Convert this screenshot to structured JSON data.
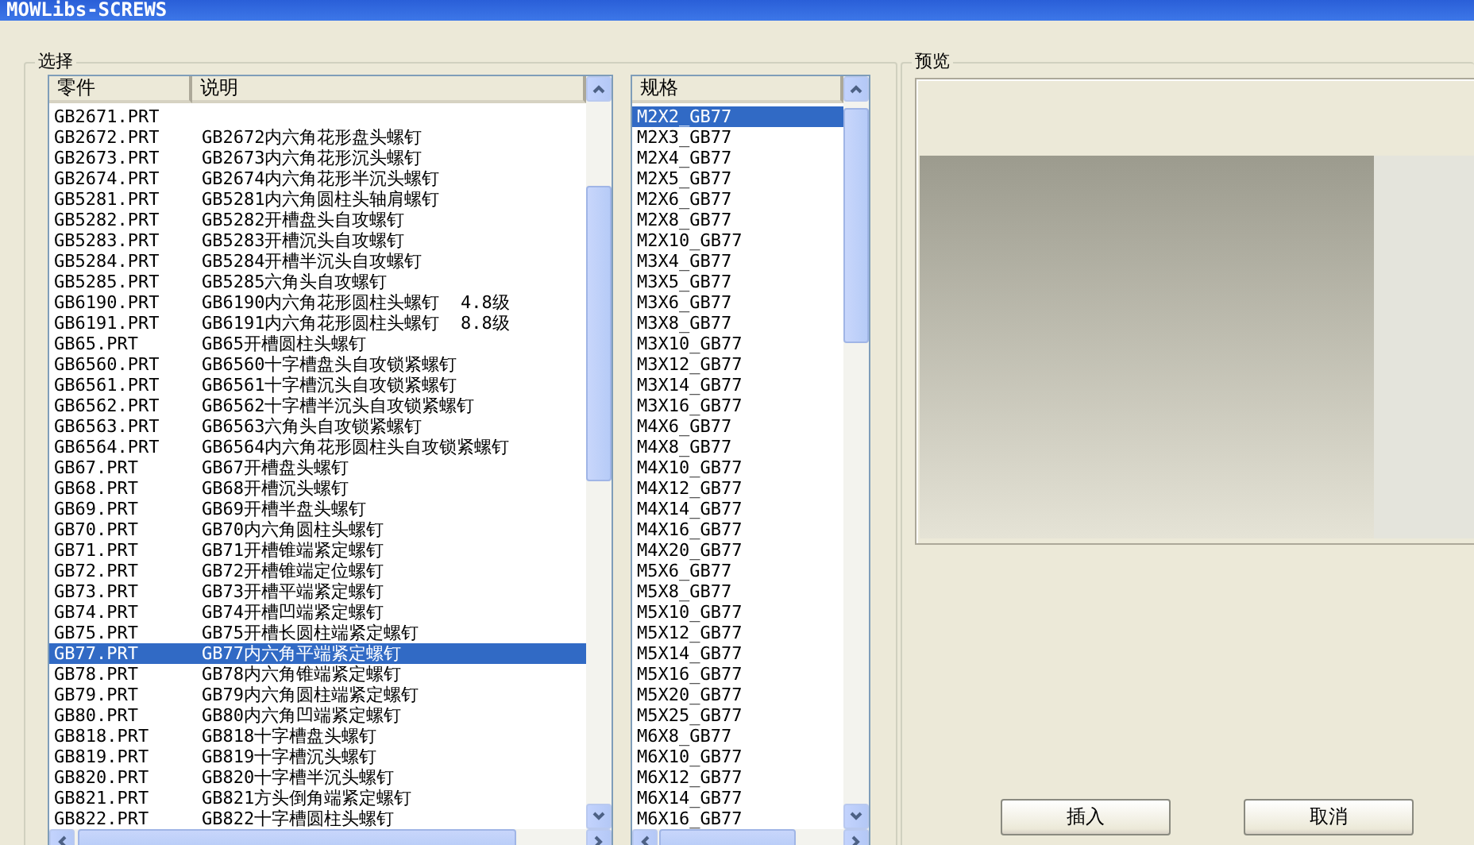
{
  "window": {
    "title": "MOWLibs-SCREWS"
  },
  "select_group": {
    "title": "选择",
    "table": {
      "columns": [
        "零件",
        "说明"
      ],
      "rows": [
        {
          "part": "GB2671.PRT",
          "description": "",
          "selected": false
        },
        {
          "part": "GB2672.PRT",
          "description": "GB2672内六角花形盘头螺钉",
          "selected": false
        },
        {
          "part": "GB2673.PRT",
          "description": "GB2673内六角花形沉头螺钉",
          "selected": false
        },
        {
          "part": "GB2674.PRT",
          "description": "GB2674内六角花形半沉头螺钉",
          "selected": false
        },
        {
          "part": "GB5281.PRT",
          "description": "GB5281内六角圆柱头轴肩螺钉",
          "selected": false
        },
        {
          "part": "GB5282.PRT",
          "description": "GB5282开槽盘头自攻螺钉",
          "selected": false
        },
        {
          "part": "GB5283.PRT",
          "description": "GB5283开槽沉头自攻螺钉",
          "selected": false
        },
        {
          "part": "GB5284.PRT",
          "description": "GB5284开槽半沉头自攻螺钉",
          "selected": false
        },
        {
          "part": "GB5285.PRT",
          "description": "GB5285六角头自攻螺钉",
          "selected": false
        },
        {
          "part": "GB6190.PRT",
          "description": "GB6190内六角花形圆柱头螺钉  4.8级",
          "selected": false
        },
        {
          "part": "GB6191.PRT",
          "description": "GB6191内六角花形圆柱头螺钉  8.8级",
          "selected": false
        },
        {
          "part": "GB65.PRT",
          "description": "GB65开槽圆柱头螺钉",
          "selected": false
        },
        {
          "part": "GB6560.PRT",
          "description": "GB6560十字槽盘头自攻锁紧螺钉",
          "selected": false
        },
        {
          "part": "GB6561.PRT",
          "description": "GB6561十字槽沉头自攻锁紧螺钉",
          "selected": false
        },
        {
          "part": "GB6562.PRT",
          "description": "GB6562十字槽半沉头自攻锁紧螺钉",
          "selected": false
        },
        {
          "part": "GB6563.PRT",
          "description": "GB6563六角头自攻锁紧螺钉",
          "selected": false
        },
        {
          "part": "GB6564.PRT",
          "description": "GB6564内六角花形圆柱头自攻锁紧螺钉",
          "selected": false
        },
        {
          "part": "GB67.PRT",
          "description": "GB67开槽盘头螺钉",
          "selected": false
        },
        {
          "part": "GB68.PRT",
          "description": "GB68开槽沉头螺钉",
          "selected": false
        },
        {
          "part": "GB69.PRT",
          "description": "GB69开槽半盘头螺钉",
          "selected": false
        },
        {
          "part": "GB70.PRT",
          "description": "GB70内六角圆柱头螺钉",
          "selected": false
        },
        {
          "part": "GB71.PRT",
          "description": "GB71开槽锥端紧定螺钉",
          "selected": false
        },
        {
          "part": "GB72.PRT",
          "description": "GB72开槽锥端定位螺钉",
          "selected": false
        },
        {
          "part": "GB73.PRT",
          "description": "GB73开槽平端紧定螺钉",
          "selected": false
        },
        {
          "part": "GB74.PRT",
          "description": "GB74开槽凹端紧定螺钉",
          "selected": false
        },
        {
          "part": "GB75.PRT",
          "description": "GB75开槽长圆柱端紧定螺钉",
          "selected": false
        },
        {
          "part": "GB77.PRT",
          "description": "GB77内六角平端紧定螺钉",
          "selected": true
        },
        {
          "part": "GB78.PRT",
          "description": "GB78内六角锥端紧定螺钉",
          "selected": false
        },
        {
          "part": "GB79.PRT",
          "description": "GB79内六角圆柱端紧定螺钉",
          "selected": false
        },
        {
          "part": "GB80.PRT",
          "description": "GB80内六角凹端紧定螺钉",
          "selected": false
        },
        {
          "part": "GB818.PRT",
          "description": "GB818十字槽盘头螺钉",
          "selected": false
        },
        {
          "part": "GB819.PRT",
          "description": "GB819十字槽沉头螺钉",
          "selected": false
        },
        {
          "part": "GB820.PRT",
          "description": "GB820十字槽半沉头螺钉",
          "selected": false
        },
        {
          "part": "GB821.PRT",
          "description": "GB821方头倒角端紧定螺钉",
          "selected": false
        },
        {
          "part": "GB822.PRT",
          "description": "GB822十字槽圆柱头螺钉",
          "selected": false
        }
      ]
    },
    "spec_list": {
      "column": "规格",
      "items": [
        {
          "label": "M2X2_GB77",
          "selected": true
        },
        {
          "label": "M2X3_GB77",
          "selected": false
        },
        {
          "label": "M2X4_GB77",
          "selected": false
        },
        {
          "label": "M2X5_GB77",
          "selected": false
        },
        {
          "label": "M2X6_GB77",
          "selected": false
        },
        {
          "label": "M2X8_GB77",
          "selected": false
        },
        {
          "label": "M2X10_GB77",
          "selected": false
        },
        {
          "label": "M3X4_GB77",
          "selected": false
        },
        {
          "label": "M3X5_GB77",
          "selected": false
        },
        {
          "label": "M3X6_GB77",
          "selected": false
        },
        {
          "label": "M3X8_GB77",
          "selected": false
        },
        {
          "label": "M3X10_GB77",
          "selected": false
        },
        {
          "label": "M3X12_GB77",
          "selected": false
        },
        {
          "label": "M3X14_GB77",
          "selected": false
        },
        {
          "label": "M3X16_GB77",
          "selected": false
        },
        {
          "label": "M4X6_GB77",
          "selected": false
        },
        {
          "label": "M4X8_GB77",
          "selected": false
        },
        {
          "label": "M4X10_GB77",
          "selected": false
        },
        {
          "label": "M4X12_GB77",
          "selected": false
        },
        {
          "label": "M4X14_GB77",
          "selected": false
        },
        {
          "label": "M4X16_GB77",
          "selected": false
        },
        {
          "label": "M4X20_GB77",
          "selected": false
        },
        {
          "label": "M5X6_GB77",
          "selected": false
        },
        {
          "label": "M5X8_GB77",
          "selected": false
        },
        {
          "label": "M5X10_GB77",
          "selected": false
        },
        {
          "label": "M5X12_GB77",
          "selected": false
        },
        {
          "label": "M5X14_GB77",
          "selected": false
        },
        {
          "label": "M5X16_GB77",
          "selected": false
        },
        {
          "label": "M5X20_GB77",
          "selected": false
        },
        {
          "label": "M5X25_GB77",
          "selected": false
        },
        {
          "label": "M6X8_GB77",
          "selected": false
        },
        {
          "label": "M6X10_GB77",
          "selected": false
        },
        {
          "label": "M6X12_GB77",
          "selected": false
        },
        {
          "label": "M6X14_GB77",
          "selected": false
        },
        {
          "label": "M6X16_GB77",
          "selected": false
        }
      ]
    }
  },
  "preview_group": {
    "title": "预览"
  },
  "buttons": [
    {
      "label": "插入"
    },
    {
      "label": "取消"
    }
  ]
}
